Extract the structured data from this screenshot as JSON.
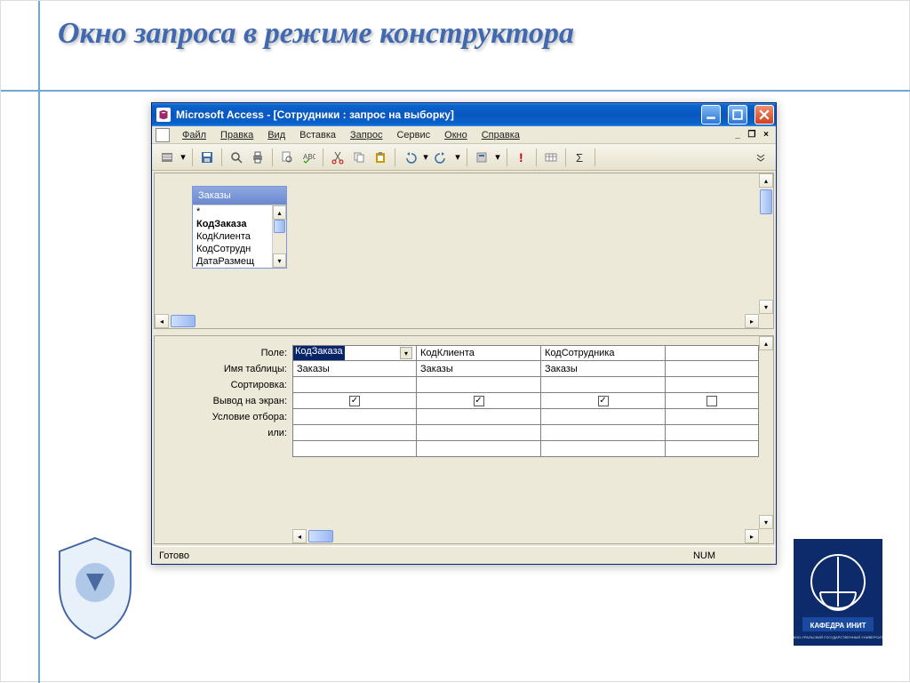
{
  "slide_title": "Окно запроса в режиме конструктора",
  "window": {
    "title": "Microsoft Access - [Сотрудники : запрос на выборку]",
    "menu": [
      "Файл",
      "Правка",
      "Вид",
      "Вставка",
      "Запрос",
      "Сервис",
      "Окно",
      "Справка"
    ],
    "tablebox": {
      "title": "Заказы",
      "items": [
        "*",
        "КодЗаказа",
        "КодКлиента",
        "КодСотрудн",
        "ДатаРазмещ"
      ]
    },
    "grid": {
      "labels": [
        "Поле:",
        "Имя таблицы:",
        "Сортировка:",
        "Вывод на экран:",
        "Условие отбора:",
        "или:"
      ],
      "columns": [
        {
          "field": "КодЗаказа",
          "table": "Заказы",
          "sort": "",
          "show": true,
          "criteria": "",
          "or": ""
        },
        {
          "field": "КодКлиента",
          "table": "Заказы",
          "sort": "",
          "show": true,
          "criteria": "",
          "or": ""
        },
        {
          "field": "КодСотрудника",
          "table": "Заказы",
          "sort": "",
          "show": true,
          "criteria": "",
          "or": ""
        }
      ]
    },
    "status": {
      "left": "Готово",
      "right": "NUM"
    }
  }
}
